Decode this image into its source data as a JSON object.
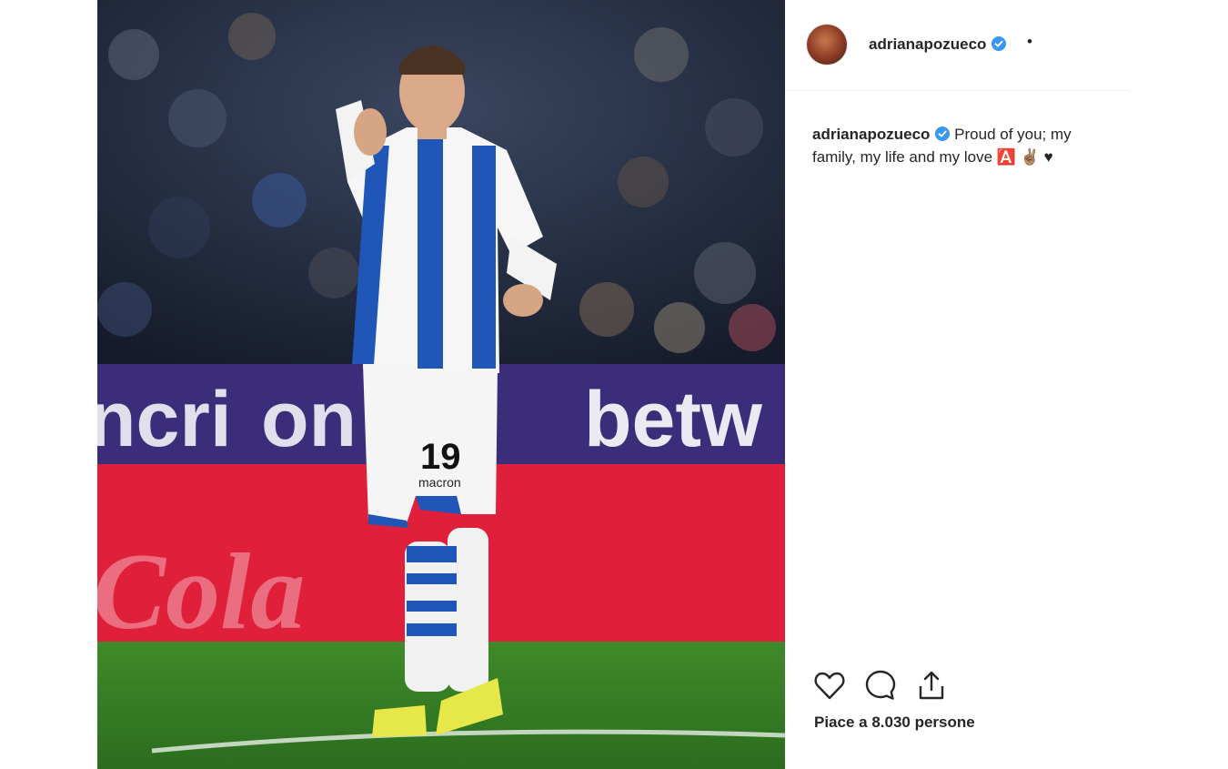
{
  "post": {
    "username": "adrianapozueco",
    "separator": "•",
    "caption_text": "Proud of you; my family, my life and my love",
    "caption_emojis": [
      "🅰️",
      "✌🏽",
      "♥"
    ],
    "likes_text": "Piace a 8.030 persone"
  },
  "photo": {
    "jersey_number": "19",
    "shorts_brand": "macron",
    "board_text_1": "ncri",
    "board_text_2": "on",
    "board_text_3": "betw",
    "ad_text_red": "Cola"
  },
  "icons": {
    "verified": "verified-badge-icon",
    "like": "heart-icon",
    "comment": "comment-icon",
    "share": "share-icon"
  },
  "colors": {
    "verified_blue": "#3897f0",
    "text": "#262626",
    "divider": "#efefef"
  }
}
